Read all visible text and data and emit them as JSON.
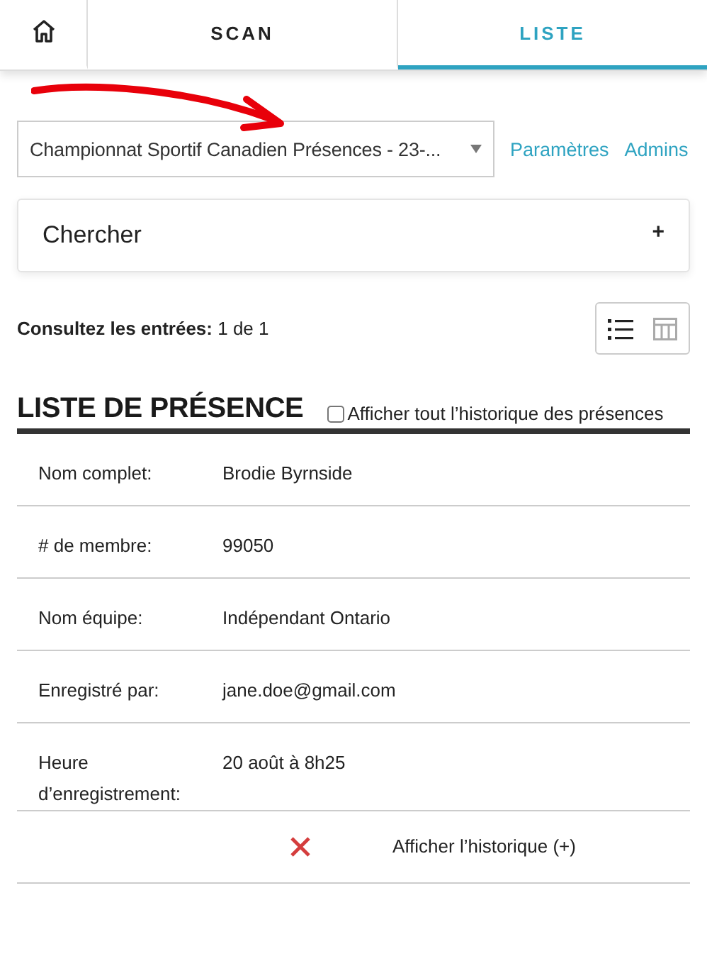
{
  "tabs": [
    {
      "kind": "home",
      "selected": false
    },
    {
      "kind": "text",
      "label": "SCAN",
      "selected": false
    },
    {
      "kind": "text",
      "label": "LISTE",
      "selected": true
    }
  ],
  "event_select": {
    "value": "Championnat Sportif Canadien Présences - 23-..."
  },
  "links": [
    "Paramètres",
    "Admins"
  ],
  "search_panel": {
    "title": "Chercher",
    "toggle": "+"
  },
  "entries": {
    "text": "**Consultez les entrées:** 1 de 1"
  },
  "view_modes": [
    {
      "kind": "list",
      "selected": true
    },
    {
      "kind": "table",
      "selected": false
    }
  ],
  "attendance": {
    "title": "LISTE DE PRÉSENCE",
    "show_all_history": {
      "label": "Afficher tout l’historique des présences",
      "checked": false
    },
    "fields": [
      {
        "label": "Nom complet:",
        "value": "Brodie Byrnside"
      },
      {
        "label": "# de membre:",
        "value": "99050"
      },
      {
        "label": "Nom équipe:",
        "value": "Indépendant Ontario"
      },
      {
        "label": "Enregistré par:",
        "value": "jane.doe@gmail.com"
      },
      {
        "label": "Heure d’enregistrement:",
        "value": "20 août à 8h25"
      }
    ],
    "history_link": "Afficher l’historique (+)"
  }
}
